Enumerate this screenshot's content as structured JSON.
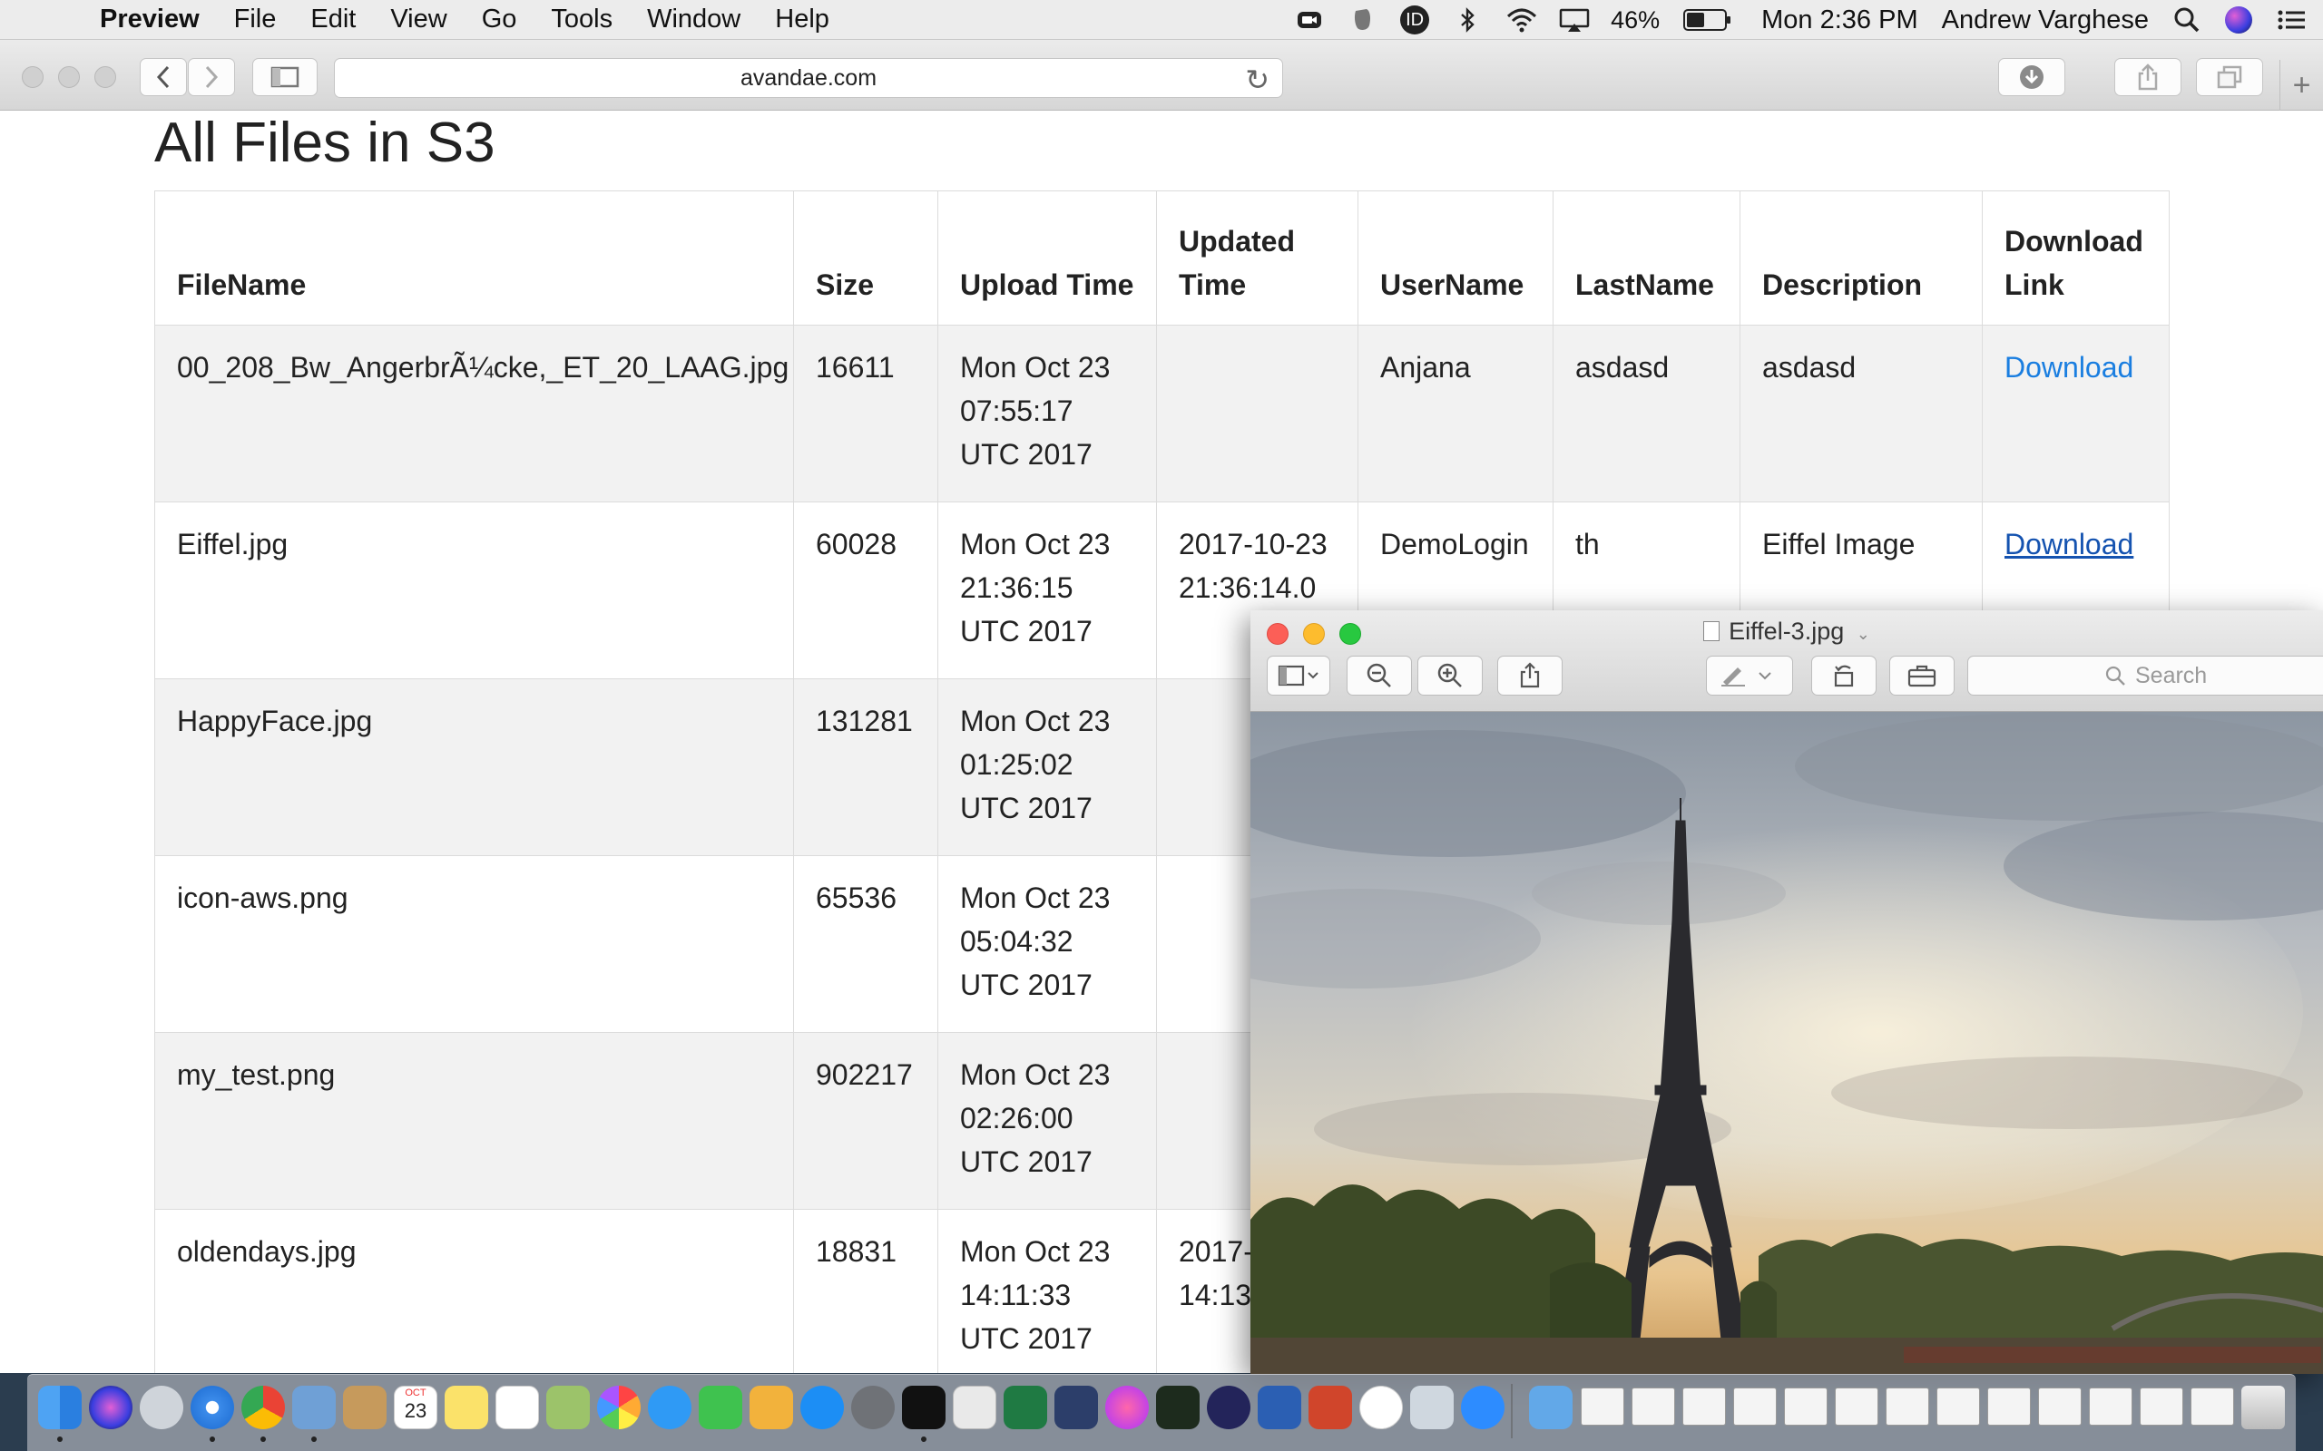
{
  "menubar": {
    "app_name": "Preview",
    "items": [
      "File",
      "Edit",
      "View",
      "Go",
      "Tools",
      "Window",
      "Help"
    ],
    "battery_percent": "46%",
    "battery_level": 0.46,
    "clock": "Mon 2:36 PM",
    "user_name": "Andrew Varghese"
  },
  "browser": {
    "url": "avandae.com"
  },
  "page": {
    "title": "All Files in S3",
    "columns": [
      "FileName",
      "Size",
      "Upload Time",
      "Updated Time",
      "UserName",
      "LastName",
      "Description",
      "Download Link"
    ],
    "rows": [
      {
        "filename": "00_208_Bw_AngerbrÃ¼cke,_ET_20_LAAG.jpg",
        "size": "16611",
        "upload": "Mon Oct 23 07:55:17 UTC 2017",
        "updated": "",
        "username": "Anjana",
        "lastname": "asdasd",
        "description": "asdasd",
        "link": "Download"
      },
      {
        "filename": "Eiffel.jpg",
        "size": "60028",
        "upload": "Mon Oct 23 21:36:15 UTC 2017",
        "updated": "2017-10-23 21:36:14.0",
        "username": "DemoLogin",
        "lastname": "th",
        "description": "Eiffel Image",
        "link": "Download"
      },
      {
        "filename": "HappyFace.jpg",
        "size": "131281",
        "upload": "Mon Oct 23 01:25:02 UTC 2017",
        "updated": "",
        "username": "",
        "lastname": "",
        "description": "",
        "link": ""
      },
      {
        "filename": "icon-aws.png",
        "size": "65536",
        "upload": "Mon Oct 23 05:04:32 UTC 2017",
        "updated": "",
        "username": "",
        "lastname": "",
        "description": "",
        "link": ""
      },
      {
        "filename": "my_test.png",
        "size": "902217",
        "upload": "Mon Oct 23 02:26:00 UTC 2017",
        "updated": "",
        "username": "",
        "lastname": "",
        "description": "",
        "link": ""
      },
      {
        "filename": "oldendays.jpg",
        "size": "18831",
        "upload": "Mon Oct 23 14:11:33 UTC 2017",
        "updated": "2017-10-23 14:13:",
        "username": "",
        "lastname": "",
        "description": "",
        "link": ""
      }
    ]
  },
  "preview_window": {
    "title": "Eiffel-3.jpg",
    "search_placeholder": "Search"
  },
  "dock": {
    "calendar_month": "OCT",
    "calendar_day": "23"
  }
}
